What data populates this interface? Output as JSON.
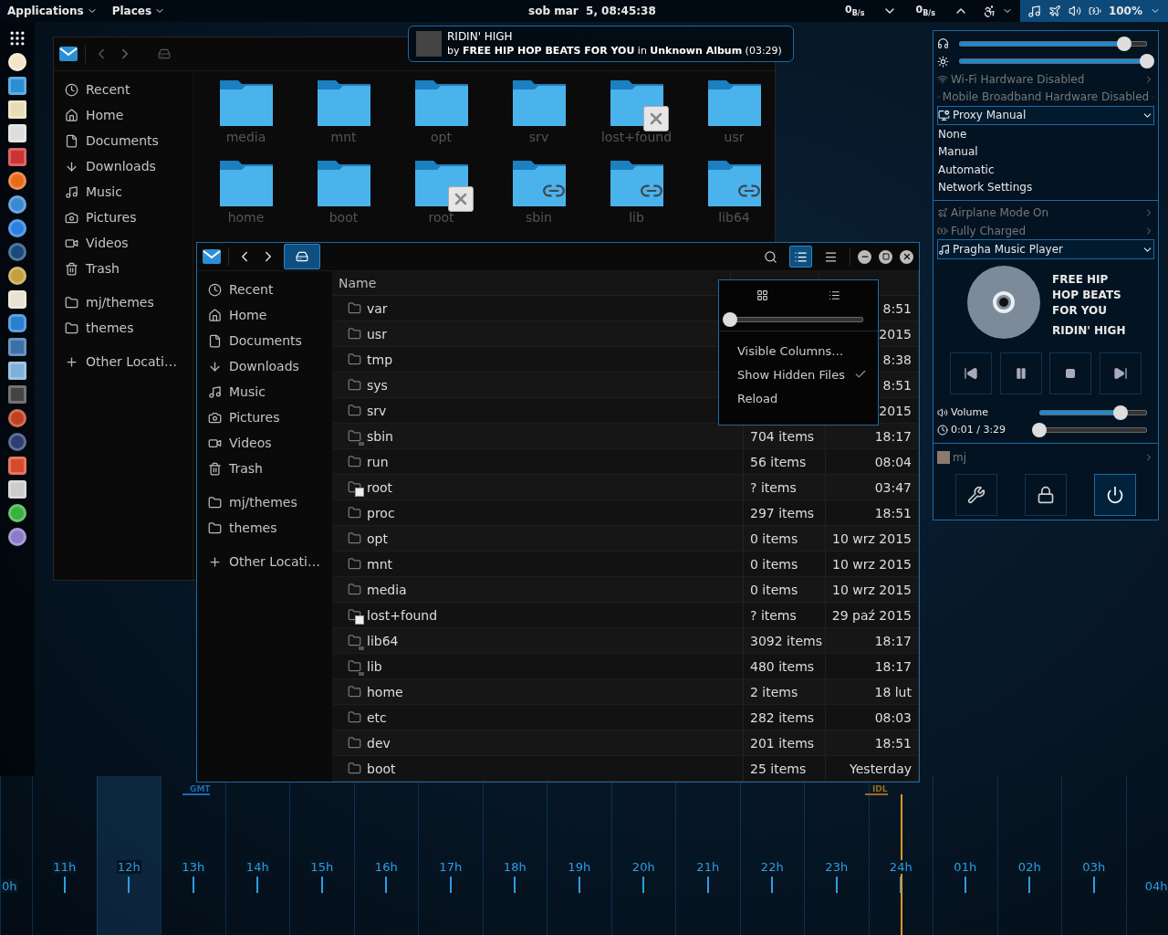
{
  "top_bar": {
    "menus": [
      {
        "label": "Applications"
      },
      {
        "label": "Places"
      }
    ],
    "clock": "sob mar  5, 08:45:38",
    "net_down": "0$_{B/s}$",
    "net_up": "0$_{B/s}$",
    "battery": "100%"
  },
  "notification": {
    "title": "RIDIN' HIGH",
    "body": "by **FREE HIP HOP BEATS FOR YOU** in **Unknown Album** (03:29)"
  },
  "back_window": {
    "sidebar": [
      {
        "label": "Recent",
        "kind": "recent"
      },
      {
        "label": "Home",
        "kind": "home"
      },
      {
        "label": "Documents",
        "kind": "documents"
      },
      {
        "label": "Downloads",
        "kind": "downloads"
      },
      {
        "label": "Music",
        "kind": "music"
      },
      {
        "label": "Pictures",
        "kind": "pictures"
      },
      {
        "label": "Videos",
        "kind": "videos"
      },
      {
        "label": "Trash",
        "kind": "trash"
      },
      {
        "label": "mj/themes",
        "kind": "folder"
      },
      {
        "label": "themes",
        "kind": "folder"
      },
      {
        "label": "Other Locati…",
        "kind": "other"
      }
    ],
    "folders": [
      {
        "name": "media",
        "kind": "folder"
      },
      {
        "name": "mnt",
        "kind": "folder"
      },
      {
        "name": "opt",
        "kind": "folder"
      },
      {
        "name": "srv",
        "kind": "folder"
      },
      {
        "name": "lost+found",
        "kind": "unreadable"
      },
      {
        "name": "usr",
        "kind": "folder"
      },
      {
        "name": "home",
        "kind": "folder"
      },
      {
        "name": "boot",
        "kind": "folder"
      },
      {
        "name": "root",
        "kind": "unreadable"
      },
      {
        "name": "sbin",
        "kind": "link"
      },
      {
        "name": "lib",
        "kind": "link"
      },
      {
        "name": "lib64",
        "kind": "link"
      }
    ]
  },
  "front_window": {
    "location_selected": true,
    "list_view_selected": true,
    "sidebar": [
      {
        "label": "Recent",
        "kind": "recent"
      },
      {
        "label": "Home",
        "kind": "home"
      },
      {
        "label": "Documents",
        "kind": "documents"
      },
      {
        "label": "Downloads",
        "kind": "downloads"
      },
      {
        "label": "Music",
        "kind": "music"
      },
      {
        "label": "Pictures",
        "kind": "pictures"
      },
      {
        "label": "Videos",
        "kind": "videos"
      },
      {
        "label": "Trash",
        "kind": "trash"
      },
      {
        "label": "mj/themes",
        "kind": "folder"
      },
      {
        "label": "themes",
        "kind": "folder"
      },
      {
        "label": "Other Locati…",
        "kind": "other"
      }
    ],
    "columns": [
      "Name"
    ],
    "rows": [
      {
        "name": "var",
        "kind": "folder",
        "modified": "8:51"
      },
      {
        "name": "usr",
        "kind": "folder",
        "modified": "2015"
      },
      {
        "name": "tmp",
        "kind": "folder",
        "modified": "8:38"
      },
      {
        "name": "sys",
        "kind": "folder",
        "modified": "8:51"
      },
      {
        "name": "srv",
        "kind": "folder",
        "modified": "2015"
      },
      {
        "name": "sbin",
        "kind": "link",
        "size": "704 items",
        "modified": "18:17"
      },
      {
        "name": "run",
        "kind": "folder",
        "size": "56 items",
        "modified": "08:04"
      },
      {
        "name": "root",
        "kind": "unreadable",
        "size": "? items",
        "modified": "03:47"
      },
      {
        "name": "proc",
        "kind": "folder",
        "size": "297 items",
        "modified": "18:51"
      },
      {
        "name": "opt",
        "kind": "folder",
        "size": "0 items",
        "modified": "10 wrz 2015"
      },
      {
        "name": "mnt",
        "kind": "folder",
        "size": "0 items",
        "modified": "10 wrz 2015"
      },
      {
        "name": "media",
        "kind": "folder",
        "size": "0 items",
        "modified": "10 wrz 2015"
      },
      {
        "name": "lost+found",
        "kind": "unreadable",
        "size": "? items",
        "modified": "29 paź 2015"
      },
      {
        "name": "lib64",
        "kind": "link",
        "size": "3092 items",
        "modified": "18:17"
      },
      {
        "name": "lib",
        "kind": "link",
        "size": "480 items",
        "modified": "18:17"
      },
      {
        "name": "home",
        "kind": "folder",
        "size": "2 items",
        "modified": "18 lut"
      },
      {
        "name": "etc",
        "kind": "folder",
        "size": "282 items",
        "modified": "08:03"
      },
      {
        "name": "dev",
        "kind": "folder",
        "size": "201 items",
        "modified": "18:51"
      },
      {
        "name": "boot",
        "kind": "folder",
        "size": "25 items",
        "modified": "Yesterday"
      }
    ],
    "popover": {
      "zoom": {
        "level": 0
      },
      "items": [
        {
          "label": "Visible Columns…",
          "checked": false
        },
        {
          "label": "Show Hidden Files",
          "checked": true
        },
        {
          "label": "Reload",
          "checked": false
        }
      ]
    }
  },
  "system_menu": {
    "sliders": [
      {
        "kind": "headphones",
        "level": 0.88
      },
      {
        "kind": "brightness",
        "level": 1
      }
    ],
    "network": [
      {
        "kind": "wifi",
        "label": "Wi-Fi Hardware Disabled",
        "disabled": true
      },
      {
        "kind": "mobile",
        "label": "Mobile Broadband Hardware Disabled",
        "disabled": true
      }
    ],
    "proxy": {
      "label": "Proxy Manual",
      "expanded": true,
      "options": [
        "None",
        "Manual",
        "Automatic",
        "Network Settings"
      ]
    },
    "status": [
      {
        "kind": "airplane",
        "label": "Airplane Mode On",
        "disabled": true
      },
      {
        "kind": "battery",
        "label": "Fully Charged",
        "disabled": true
      }
    ],
    "player": {
      "label": "Pragha Music Player",
      "expanded": true,
      "artist": "FREE HIP HOP BEATS FOR YOU",
      "title": "RIDIN' HIGH",
      "volume_label": "Volume",
      "volume": {
        "level": 0.75
      },
      "time": "0:01 / 3:29",
      "progress": {
        "level": 0
      }
    },
    "user": {
      "name": "mj"
    },
    "actions": [
      {
        "kind": "settings",
        "selected": false
      },
      {
        "kind": "lock",
        "selected": false
      },
      {
        "kind": "power",
        "selected": true
      }
    ]
  },
  "timeline": {
    "gmt": "GMT",
    "idl": "IDL",
    "hours": [
      {
        "label": "0h",
        "highlighted": false,
        "date_line": false
      },
      {
        "label": "11h",
        "highlighted": false,
        "date_line": false
      },
      {
        "label": "12h",
        "highlighted": true,
        "date_line": false
      },
      {
        "label": "13h",
        "highlighted": false,
        "date_line": false
      },
      {
        "label": "14h",
        "highlighted": false,
        "date_line": false
      },
      {
        "label": "15h",
        "highlighted": false,
        "date_line": false
      },
      {
        "label": "16h",
        "highlighted": false,
        "date_line": false
      },
      {
        "label": "17h",
        "highlighted": false,
        "date_line": false
      },
      {
        "label": "18h",
        "highlighted": false,
        "date_line": false
      },
      {
        "label": "19h",
        "highlighted": false,
        "date_line": false
      },
      {
        "label": "20h",
        "highlighted": false,
        "date_line": false
      },
      {
        "label": "21h",
        "highlighted": false,
        "date_line": false
      },
      {
        "label": "22h",
        "highlighted": false,
        "date_line": false
      },
      {
        "label": "23h",
        "highlighted": false,
        "date_line": false
      },
      {
        "label": "24h",
        "highlighted": false,
        "date_line": true
      },
      {
        "label": "01h",
        "highlighted": false,
        "date_line": false
      },
      {
        "label": "02h",
        "highlighted": false,
        "date_line": false
      },
      {
        "label": "03h",
        "highlighted": false,
        "date_line": false
      },
      {
        "label": "04h",
        "highlighted": false,
        "date_line": false
      }
    ]
  }
}
